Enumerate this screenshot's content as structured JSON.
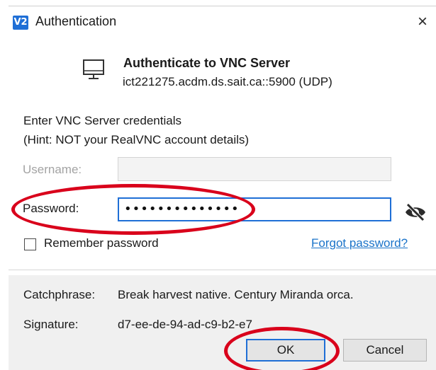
{
  "window": {
    "logo_text": "V2",
    "title": "Authentication",
    "close_symbol": "×",
    "logo_icon": "realvnc-logo-icon",
    "close_icon": "close-icon"
  },
  "header": {
    "icon": "computer-monitor-icon",
    "title": "Authenticate to VNC Server",
    "address": "ict221275.acdm.ds.sait.ca::5900 (UDP)"
  },
  "instructions": {
    "line1": "Enter VNC Server credentials",
    "line2": "(Hint: NOT your RealVNC account details)"
  },
  "form": {
    "username": {
      "label": "Username:",
      "value": "",
      "disabled": true
    },
    "password": {
      "label": "Password:",
      "masked_value": "••••••••••••••",
      "reveal_icon": "eye-slash-icon"
    },
    "remember": {
      "label": "Remember password",
      "checked": false
    },
    "forgot_link": "Forgot password?"
  },
  "details": {
    "catchphrase_label": "Catchphrase:",
    "catchphrase_value": "Break harvest native. Century Miranda orca.",
    "signature_label": "Signature:",
    "signature_value": "d7-ee-de-94-ad-c9-b2-e7"
  },
  "buttons": {
    "ok": "OK",
    "cancel": "Cancel"
  },
  "colors": {
    "accent": "#1f6fd6",
    "link": "#1a73c9",
    "annotation": "#d9001b",
    "footer_bg": "#f0f0f0"
  }
}
